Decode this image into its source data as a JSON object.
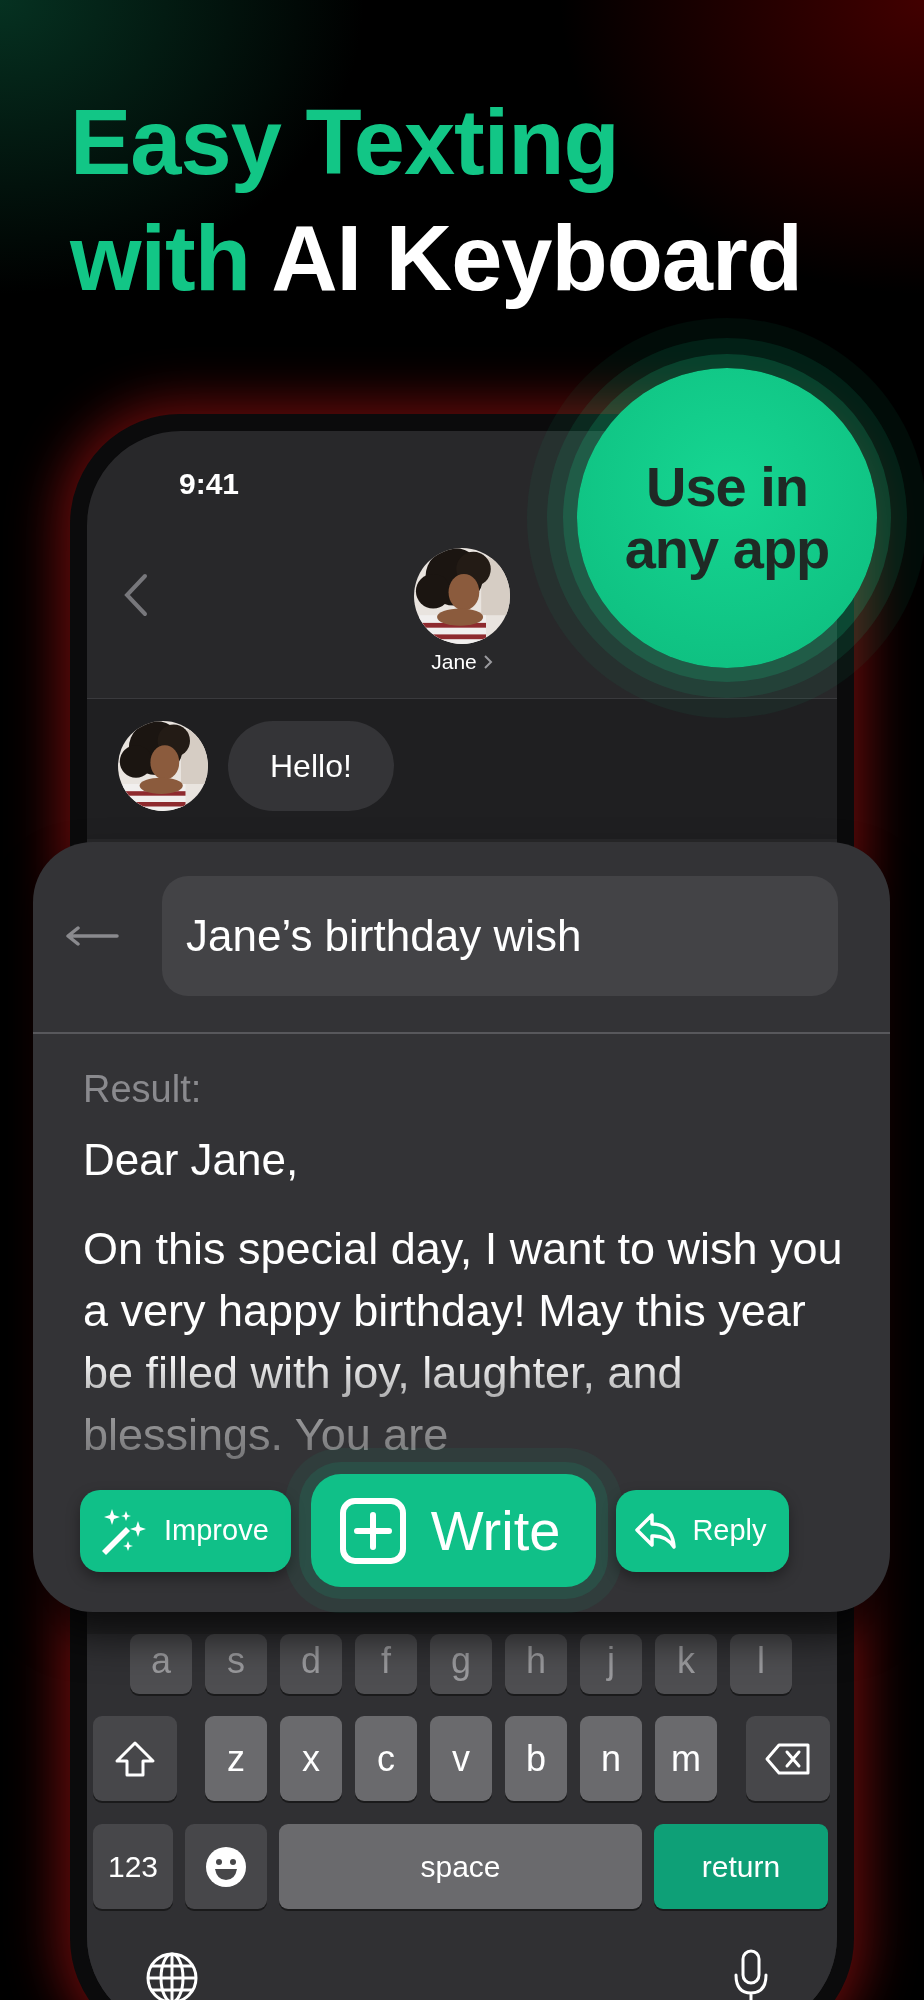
{
  "headline": {
    "line_1": "Easy Texting",
    "line_2_accent": "with",
    "line_2": "AI Keyboard"
  },
  "badge": {
    "text": "Use in any app"
  },
  "status_bar": {
    "time": "9:41"
  },
  "contact": {
    "name": "Jane"
  },
  "messages": [
    {
      "text": "Hello!"
    }
  ],
  "assistant": {
    "prompt": "Jane’s birthday wish",
    "result_label": "Result:",
    "greeting": "Dear Jane,",
    "body": "On this special day, I want to wish you a very happy birthday! May this year be filled with joy, laughter, and blessings. You are",
    "actions": [
      {
        "label": "Improve",
        "kind": "improve"
      },
      {
        "label": "Write",
        "kind": "write"
      },
      {
        "label": "Reply",
        "kind": "reply"
      }
    ]
  },
  "keyboard": {
    "rows": [
      {
        "keys": [
          {
            "kind": "letter",
            "label": "a"
          },
          {
            "kind": "letter",
            "label": "s"
          },
          {
            "kind": "letter",
            "label": "d"
          },
          {
            "kind": "letter",
            "label": "f"
          },
          {
            "kind": "letter",
            "label": "g"
          },
          {
            "kind": "letter",
            "label": "h"
          },
          {
            "kind": "letter",
            "label": "j"
          },
          {
            "kind": "letter",
            "label": "k"
          },
          {
            "kind": "letter",
            "label": "l"
          }
        ]
      },
      {
        "keys": [
          {
            "kind": "shift"
          },
          {
            "kind": "letter",
            "label": "z"
          },
          {
            "kind": "letter",
            "label": "x"
          },
          {
            "kind": "letter",
            "label": "c"
          },
          {
            "kind": "letter",
            "label": "v"
          },
          {
            "kind": "letter",
            "label": "b"
          },
          {
            "kind": "letter",
            "label": "n"
          },
          {
            "kind": "letter",
            "label": "m"
          },
          {
            "kind": "delete"
          }
        ]
      },
      {
        "keys": [
          {
            "kind": "mode",
            "label": "123"
          },
          {
            "kind": "emoji"
          },
          {
            "kind": "space",
            "label": "space"
          },
          {
            "kind": "return",
            "label": "return"
          }
        ]
      }
    ]
  }
}
